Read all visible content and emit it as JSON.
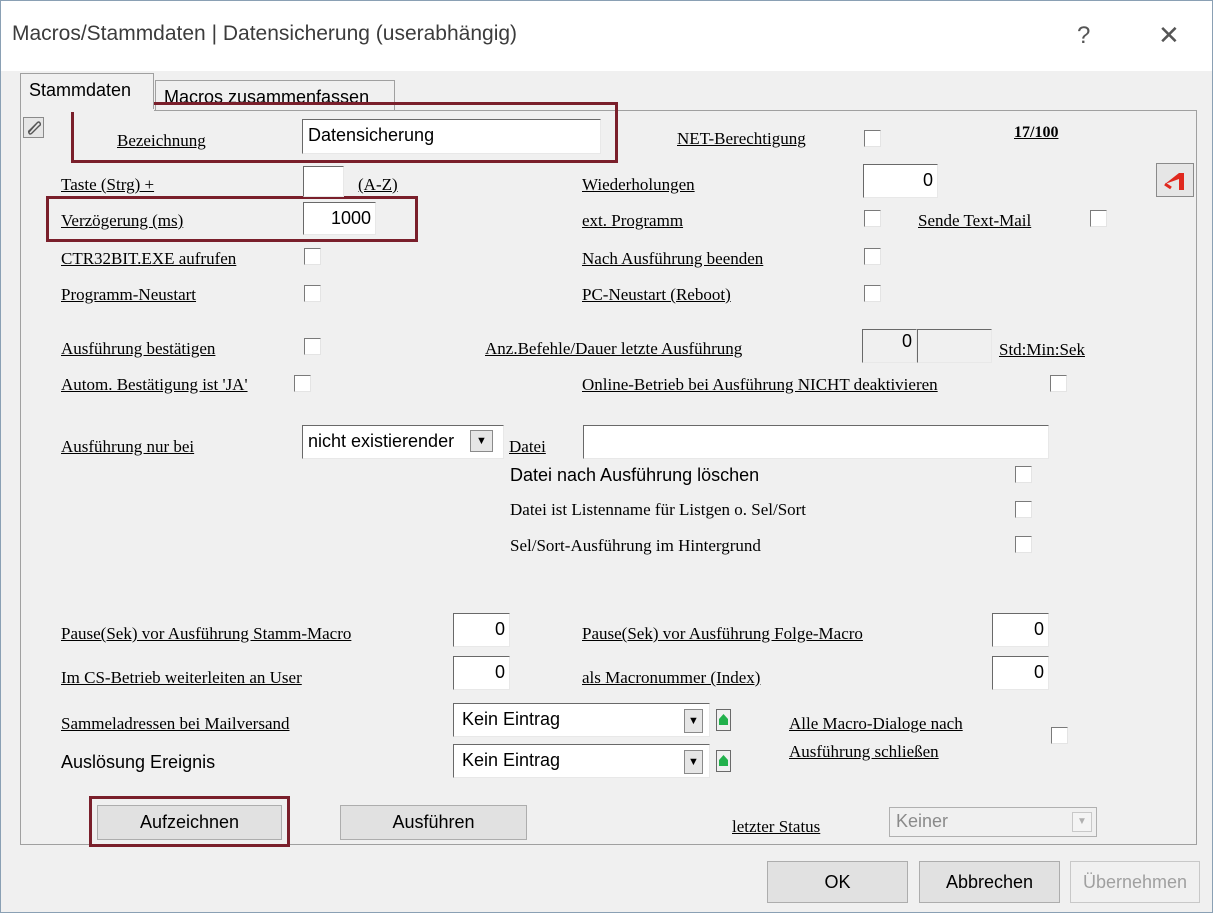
{
  "window": {
    "title": "Macros/Stammdaten | Datensicherung (userabhängig)",
    "help_glyph": "?",
    "close_glyph": "✕"
  },
  "tabs": [
    {
      "label": "Stammdaten",
      "active": true
    },
    {
      "label": "Macros zusammenfassen",
      "active": false
    }
  ],
  "form": {
    "bezeichnung_label": "Bezeichnung",
    "bezeichnung_value": "Datensicherung",
    "net_berechtigung_label": "NET-Berechtigung",
    "counter": "17/100",
    "taste_label": "Taste (Strg) +",
    "taste_value": "",
    "taste_suffix": "(A-Z)",
    "wiederholungen_label": "Wiederholungen",
    "wiederholungen_value": "0",
    "verzoegerung_label": "Verzögerung (ms)",
    "verzoegerung_value": "1000",
    "ext_programm_label": "ext. Programm",
    "sende_text_mail_label": "Sende Text-Mail",
    "ctr32bit_label": "CTR32BIT.EXE aufrufen",
    "nach_ausfuehrung_beenden_label": "Nach Ausführung beenden",
    "programm_neustart_label": "Programm-Neustart",
    "pc_neustart_label": "PC-Neustart (Reboot)",
    "ausfuehrung_bestaetigen_label": "Ausführung bestätigen",
    "anz_befehle_label": "Anz.Befehle/Dauer letzte Ausführung",
    "anz_befehle_value": "0",
    "dauer_value": "",
    "std_min_sek_label": "Std:Min:Sek",
    "autom_bestaetigung_label": "Autom. Bestätigung ist 'JA'",
    "online_betrieb_label": "Online-Betrieb bei Ausführung NICHT deaktivieren",
    "ausfuehrung_nur_bei_label": "Ausführung nur bei",
    "ausfuehrung_nur_bei_value": "nicht existierender",
    "datei_label": "Datei",
    "datei_value": "",
    "datei_loeschen_label": "Datei nach Ausführung löschen",
    "datei_listenname_label": "Datei ist Listenname für Listgen o. Sel/Sort",
    "sel_sort_hintergrund_label": "Sel/Sort-Ausführung im Hintergrund",
    "pause_stamm_label": "Pause(Sek) vor Ausführung Stamm-Macro",
    "pause_stamm_value": "0",
    "pause_folge_label": "Pause(Sek) vor Ausführung Folge-Macro",
    "pause_folge_value": "0",
    "cs_weiterleiten_label": "Im CS-Betrieb weiterleiten an User",
    "cs_weiterleiten_value": "0",
    "macronummer_label": "als Macronummer (Index)",
    "macronummer_value": "0",
    "sammeladressen_label": "Sammeladressen bei Mailversand",
    "sammeladressen_value": "Kein Eintrag",
    "ausloesung_label": "Auslösung Ereignis",
    "ausloesung_value": "Kein Eintrag",
    "alle_dialoge_label_1": "Alle Macro-Dialoge nach",
    "alle_dialoge_label_2": "Ausführung schließen",
    "letzter_status_label": "letzter Status",
    "letzter_status_value": "Keiner"
  },
  "buttons": {
    "aufzeichnen": "Aufzeichnen",
    "ausfuehren": "Ausführen",
    "ok": "OK",
    "abbrechen": "Abbrechen",
    "uebernehmen": "Übernehmen"
  },
  "colors": {
    "highlight": "#7a1f2b",
    "dialog_bg": "#f0f0f0",
    "green_arrow": "#22b14c",
    "red_icon": "#e0281e"
  }
}
